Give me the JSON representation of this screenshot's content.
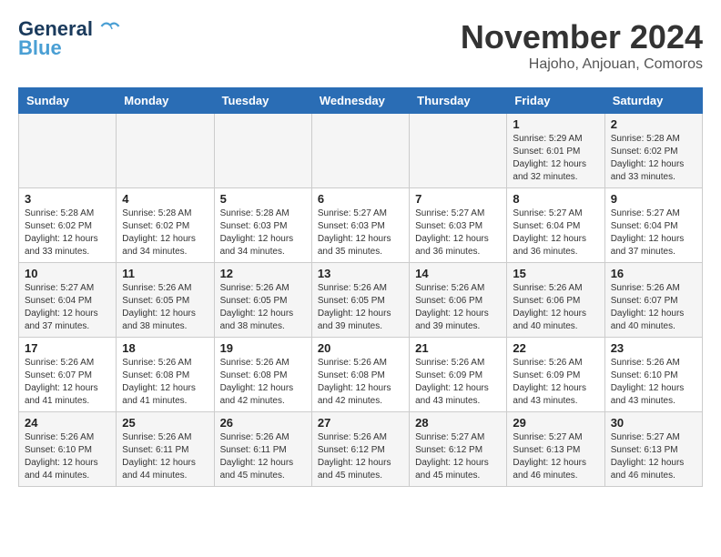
{
  "logo": {
    "line1": "General",
    "line2": "Blue"
  },
  "title": "November 2024",
  "location": "Hajoho, Anjouan, Comoros",
  "days_header": [
    "Sunday",
    "Monday",
    "Tuesday",
    "Wednesday",
    "Thursday",
    "Friday",
    "Saturday"
  ],
  "weeks": [
    [
      {
        "day": "",
        "info": ""
      },
      {
        "day": "",
        "info": ""
      },
      {
        "day": "",
        "info": ""
      },
      {
        "day": "",
        "info": ""
      },
      {
        "day": "",
        "info": ""
      },
      {
        "day": "1",
        "info": "Sunrise: 5:29 AM\nSunset: 6:01 PM\nDaylight: 12 hours\nand 32 minutes."
      },
      {
        "day": "2",
        "info": "Sunrise: 5:28 AM\nSunset: 6:02 PM\nDaylight: 12 hours\nand 33 minutes."
      }
    ],
    [
      {
        "day": "3",
        "info": "Sunrise: 5:28 AM\nSunset: 6:02 PM\nDaylight: 12 hours\nand 33 minutes."
      },
      {
        "day": "4",
        "info": "Sunrise: 5:28 AM\nSunset: 6:02 PM\nDaylight: 12 hours\nand 34 minutes."
      },
      {
        "day": "5",
        "info": "Sunrise: 5:28 AM\nSunset: 6:03 PM\nDaylight: 12 hours\nand 34 minutes."
      },
      {
        "day": "6",
        "info": "Sunrise: 5:27 AM\nSunset: 6:03 PM\nDaylight: 12 hours\nand 35 minutes."
      },
      {
        "day": "7",
        "info": "Sunrise: 5:27 AM\nSunset: 6:03 PM\nDaylight: 12 hours\nand 36 minutes."
      },
      {
        "day": "8",
        "info": "Sunrise: 5:27 AM\nSunset: 6:04 PM\nDaylight: 12 hours\nand 36 minutes."
      },
      {
        "day": "9",
        "info": "Sunrise: 5:27 AM\nSunset: 6:04 PM\nDaylight: 12 hours\nand 37 minutes."
      }
    ],
    [
      {
        "day": "10",
        "info": "Sunrise: 5:27 AM\nSunset: 6:04 PM\nDaylight: 12 hours\nand 37 minutes."
      },
      {
        "day": "11",
        "info": "Sunrise: 5:26 AM\nSunset: 6:05 PM\nDaylight: 12 hours\nand 38 minutes."
      },
      {
        "day": "12",
        "info": "Sunrise: 5:26 AM\nSunset: 6:05 PM\nDaylight: 12 hours\nand 38 minutes."
      },
      {
        "day": "13",
        "info": "Sunrise: 5:26 AM\nSunset: 6:05 PM\nDaylight: 12 hours\nand 39 minutes."
      },
      {
        "day": "14",
        "info": "Sunrise: 5:26 AM\nSunset: 6:06 PM\nDaylight: 12 hours\nand 39 minutes."
      },
      {
        "day": "15",
        "info": "Sunrise: 5:26 AM\nSunset: 6:06 PM\nDaylight: 12 hours\nand 40 minutes."
      },
      {
        "day": "16",
        "info": "Sunrise: 5:26 AM\nSunset: 6:07 PM\nDaylight: 12 hours\nand 40 minutes."
      }
    ],
    [
      {
        "day": "17",
        "info": "Sunrise: 5:26 AM\nSunset: 6:07 PM\nDaylight: 12 hours\nand 41 minutes."
      },
      {
        "day": "18",
        "info": "Sunrise: 5:26 AM\nSunset: 6:08 PM\nDaylight: 12 hours\nand 41 minutes."
      },
      {
        "day": "19",
        "info": "Sunrise: 5:26 AM\nSunset: 6:08 PM\nDaylight: 12 hours\nand 42 minutes."
      },
      {
        "day": "20",
        "info": "Sunrise: 5:26 AM\nSunset: 6:08 PM\nDaylight: 12 hours\nand 42 minutes."
      },
      {
        "day": "21",
        "info": "Sunrise: 5:26 AM\nSunset: 6:09 PM\nDaylight: 12 hours\nand 43 minutes."
      },
      {
        "day": "22",
        "info": "Sunrise: 5:26 AM\nSunset: 6:09 PM\nDaylight: 12 hours\nand 43 minutes."
      },
      {
        "day": "23",
        "info": "Sunrise: 5:26 AM\nSunset: 6:10 PM\nDaylight: 12 hours\nand 43 minutes."
      }
    ],
    [
      {
        "day": "24",
        "info": "Sunrise: 5:26 AM\nSunset: 6:10 PM\nDaylight: 12 hours\nand 44 minutes."
      },
      {
        "day": "25",
        "info": "Sunrise: 5:26 AM\nSunset: 6:11 PM\nDaylight: 12 hours\nand 44 minutes."
      },
      {
        "day": "26",
        "info": "Sunrise: 5:26 AM\nSunset: 6:11 PM\nDaylight: 12 hours\nand 45 minutes."
      },
      {
        "day": "27",
        "info": "Sunrise: 5:26 AM\nSunset: 6:12 PM\nDaylight: 12 hours\nand 45 minutes."
      },
      {
        "day": "28",
        "info": "Sunrise: 5:27 AM\nSunset: 6:12 PM\nDaylight: 12 hours\nand 45 minutes."
      },
      {
        "day": "29",
        "info": "Sunrise: 5:27 AM\nSunset: 6:13 PM\nDaylight: 12 hours\nand 46 minutes."
      },
      {
        "day": "30",
        "info": "Sunrise: 5:27 AM\nSunset: 6:13 PM\nDaylight: 12 hours\nand 46 minutes."
      }
    ]
  ]
}
